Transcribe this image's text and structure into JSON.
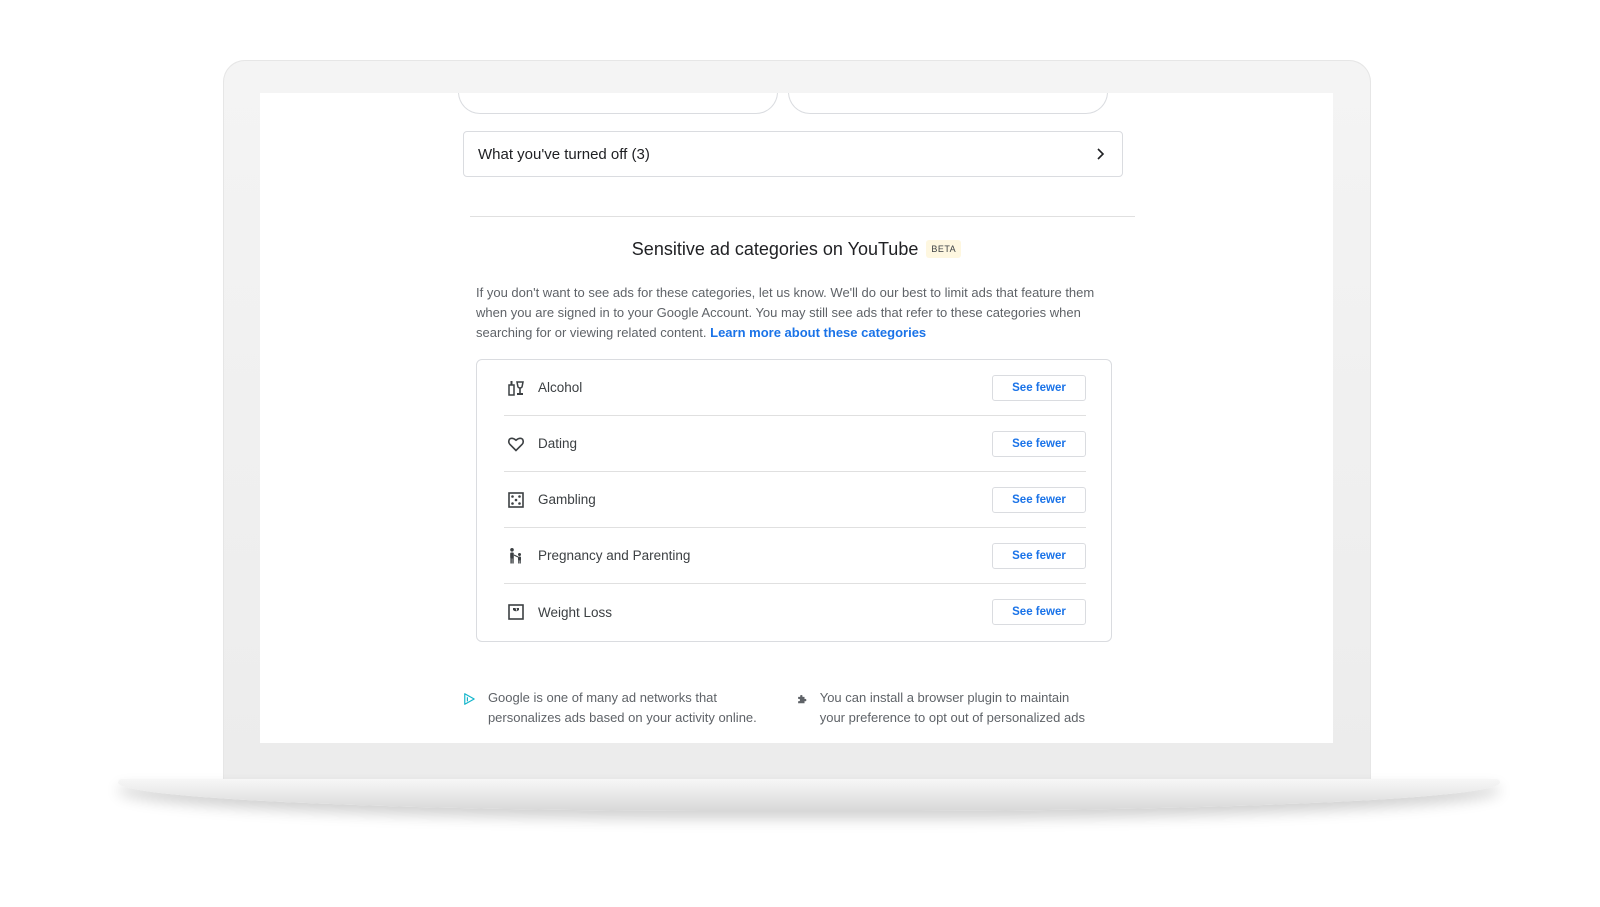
{
  "colors": {
    "accent": "#1a73e8",
    "pill_dot_left": "#4285f4",
    "pill_dot_right": "#202124",
    "beta_bg": "#fef7e0",
    "ad_icon": "#12b5cb"
  },
  "turned_off": {
    "label": "What you've turned off (3)",
    "icon": "chevron-right-icon"
  },
  "sensitive": {
    "title": "Sensitive ad categories on YouTube",
    "badge": "BETA",
    "description": "If you don't want to see ads for these categories, let us know. We'll do our best to limit ads that feature them when you are signed in to your Google Account. You may still see ads that refer to these categories when searching for or viewing related content.",
    "learn_more": "Learn more about these categories",
    "categories": [
      {
        "name": "Alcohol",
        "icon": "alcohol-icon",
        "button": "See fewer"
      },
      {
        "name": "Dating",
        "icon": "heart-icon",
        "button": "See fewer"
      },
      {
        "name": "Gambling",
        "icon": "dice-icon",
        "button": "See fewer"
      },
      {
        "name": "Pregnancy and Parenting",
        "icon": "family-icon",
        "button": "See fewer"
      },
      {
        "name": "Weight Loss",
        "icon": "scale-icon",
        "button": "See fewer"
      }
    ]
  },
  "footer": {
    "networks_text": "Google is one of many ad networks that personalizes ads based on your activity online.",
    "plugin_text": "You can install a browser plugin to maintain your preference to opt out of personalized ads",
    "networks_icon": "ad-choices-icon",
    "plugin_icon": "puzzle-icon"
  }
}
